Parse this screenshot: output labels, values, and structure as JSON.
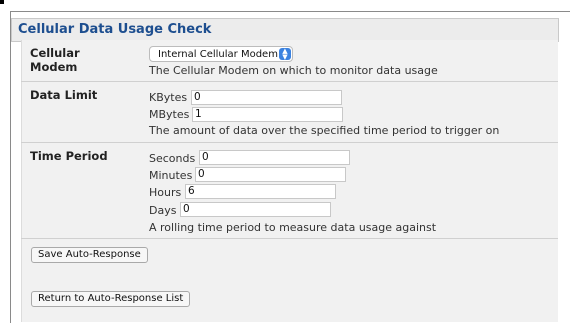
{
  "section": {
    "title": "Cellular Data Usage Check"
  },
  "modem": {
    "label": "Cellular Modem",
    "selected": "Internal Cellular Modem",
    "help": "The Cellular Modem on which to monitor data usage"
  },
  "data_limit": {
    "label": "Data Limit",
    "kbytes_label": "KBytes",
    "kbytes_value": "0",
    "mbytes_label": "MBytes",
    "mbytes_value": "1",
    "help": "The amount of data over the specified time period to trigger on"
  },
  "time_period": {
    "label": "Time Period",
    "seconds_label": "Seconds",
    "seconds_value": "0",
    "minutes_label": "Minutes",
    "minutes_value": "0",
    "hours_label": "Hours",
    "hours_value": "6",
    "days_label": "Days",
    "days_value": "0",
    "help": "A rolling time period to measure data usage against"
  },
  "buttons": {
    "save": "Save Auto-Response",
    "return": "Return to Auto-Response List"
  },
  "icons": {
    "select_arrow": "chevron-updown-icon"
  },
  "colors": {
    "title": "#1d4e8f",
    "select_accent": "#3b82e0",
    "panel": "#f1f1f1"
  }
}
